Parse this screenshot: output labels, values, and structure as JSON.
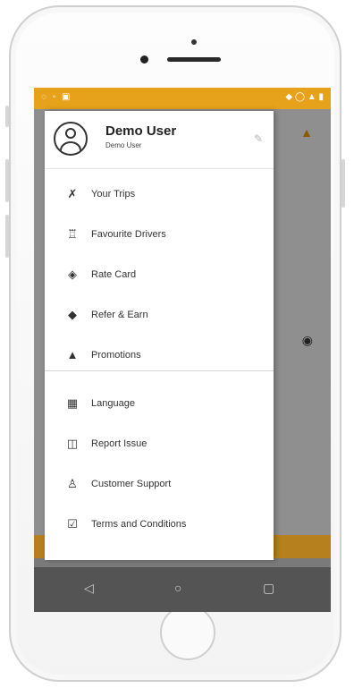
{
  "profile": {
    "name": "Demo User",
    "subtitle": "Demo User"
  },
  "menu_primary": [
    {
      "label": "Your Trips",
      "icon": "route-icon",
      "glyph": "✗"
    },
    {
      "label": "Favourite Drivers",
      "icon": "driver-icon",
      "glyph": "♖"
    },
    {
      "label": "Rate Card",
      "icon": "tag-icon",
      "glyph": "◈"
    },
    {
      "label": "Refer & Earn",
      "icon": "label-icon",
      "glyph": "◆"
    },
    {
      "label": "Promotions",
      "icon": "bell-icon",
      "glyph": "▲"
    }
  ],
  "menu_secondary": [
    {
      "label": "Language",
      "icon": "translate-icon",
      "glyph": "▦"
    },
    {
      "label": "Report Issue",
      "icon": "report-icon",
      "glyph": "◫"
    },
    {
      "label": "Customer Support",
      "icon": "support-agent-icon",
      "glyph": "♙"
    },
    {
      "label": "Terms and Conditions",
      "icon": "document-icon",
      "glyph": "☑"
    }
  ],
  "colors": {
    "status_bar": "#e6a21a",
    "accent": "#b7801e",
    "drawer_bg": "#ffffff",
    "nav_bar": "#545454"
  }
}
